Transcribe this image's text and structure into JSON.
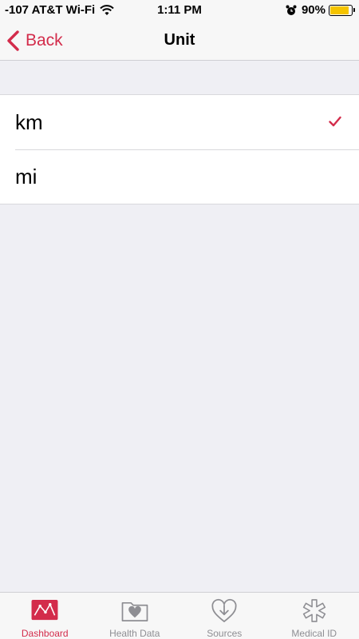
{
  "status_bar": {
    "carrier": "-107 AT&T Wi-Fi",
    "time": "1:11 PM",
    "battery": "90%",
    "battery_level": 0.9
  },
  "nav": {
    "back_label": "Back",
    "title": "Unit"
  },
  "units": [
    {
      "label": "km",
      "selected": true
    },
    {
      "label": "mi",
      "selected": false
    }
  ],
  "tabs": [
    {
      "label": "Dashboard",
      "icon": "dashboard-icon",
      "active": true
    },
    {
      "label": "Health Data",
      "icon": "health-data-icon",
      "active": false
    },
    {
      "label": "Sources",
      "icon": "sources-icon",
      "active": false
    },
    {
      "label": "Medical ID",
      "icon": "medical-id-icon",
      "active": false
    }
  ],
  "colors": {
    "accent": "#d32c4b",
    "inactive": "#8e8e93",
    "battery": "#f5c400",
    "background": "#efeff4"
  }
}
